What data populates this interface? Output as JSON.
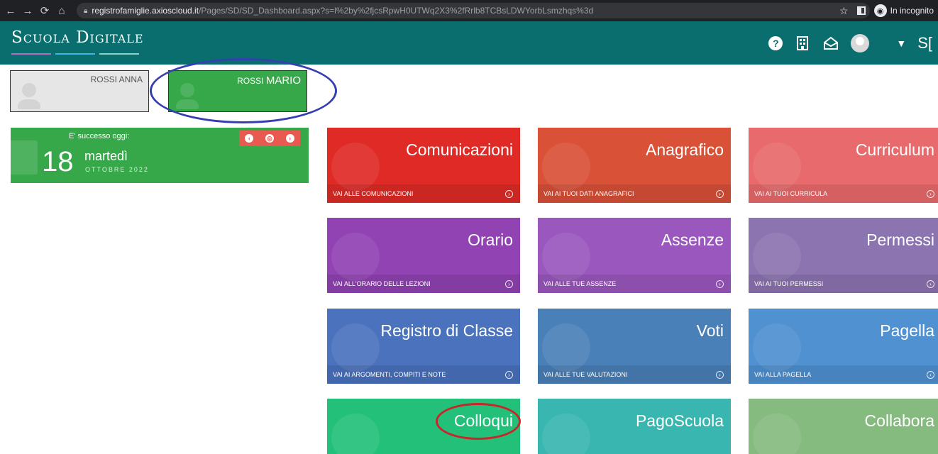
{
  "browser": {
    "url_host": "registrofamiglie.axioscloud.it",
    "url_path": "/Pages/SD/SD_Dashboard.aspx?s=l%2by%2fjcsRpwH0UTWq2X3%2fRrlb8TCBsLDWYorbLsmzhqs%3d",
    "incognito_label": "In incognito"
  },
  "app": {
    "brand": "Scuola Digitale",
    "brand_colors": [
      "#b56cc8",
      "#3db7e4",
      "#8fd1c4"
    ],
    "right_partial": "S["
  },
  "students": [
    {
      "label": "ROSSI ANNA"
    },
    {
      "label_first": "ROSSI",
      "label_second": "MARIO"
    }
  ],
  "date_widget": {
    "label": "E' successo oggi:",
    "day": "18",
    "weekday": "martedì",
    "month_year": "OTTOBRE 2022"
  },
  "tiles": [
    {
      "title": "Comunicazioni",
      "footer": "VAI ALLE COMUNICAZIONI",
      "color": "#df2a26"
    },
    {
      "title": "Anagrafico",
      "footer": "VAI AI TUOI DATI ANAGRAFICI",
      "color": "#d95137"
    },
    {
      "title": "Curriculum",
      "footer": "VAI AI TUOI CURRICULA",
      "color": "#e96a6c"
    },
    {
      "title": "Orario",
      "footer": "VAI ALL'ORARIO DELLE LEZIONI",
      "color": "#9142b3"
    },
    {
      "title": "Assenze",
      "footer": "VAI ALLE TUE ASSENZE",
      "color": "#9a57bd"
    },
    {
      "title": "Permessi",
      "footer": "VAI AI TUOI PERMESSI",
      "color": "#8c74b0"
    },
    {
      "title": "Registro di Classe",
      "footer": "VAI AI ARGOMENTI, COMPITI E NOTE",
      "color": "#4a72bd"
    },
    {
      "title": "Voti",
      "footer": "VAI ALLE TUE VALUTAZIONI",
      "color": "#4a80b8"
    },
    {
      "title": "Pagella",
      "footer": "VAI ALLA PAGELLA",
      "color": "#4f91d1"
    },
    {
      "title": "Colloqui",
      "footer": "",
      "color": "#23c07a"
    },
    {
      "title": "PagoScuola",
      "footer": "",
      "color": "#39b6b0"
    },
    {
      "title": "Collabora",
      "footer": "",
      "color": "#86bb7f"
    }
  ]
}
